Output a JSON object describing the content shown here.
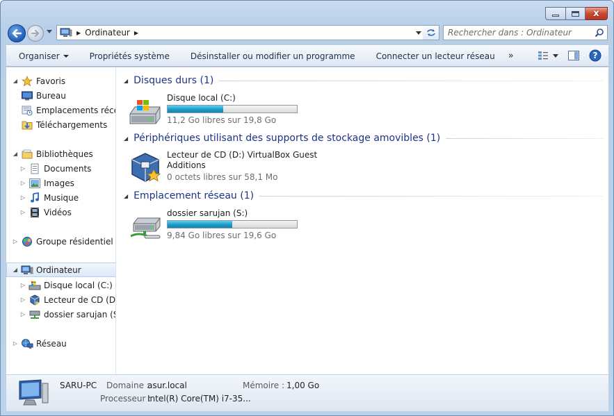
{
  "window": {
    "close_label": "x"
  },
  "address_bar": {
    "crumb": "Ordinateur"
  },
  "search": {
    "placeholder": "Rechercher dans : Ordinateur"
  },
  "command_bar": {
    "organize": "Organiser",
    "system_properties": "Propriétés système",
    "uninstall": "Désinstaller ou modifier un programme",
    "map_drive": "Connecter un lecteur réseau",
    "more": "»"
  },
  "nav_pane": {
    "favorites": "Favoris",
    "desktop": "Bureau",
    "recent_places": "Emplacements récents",
    "downloads": "Téléchargements",
    "libraries": "Bibliothèques",
    "documents": "Documents",
    "images": "Images",
    "music": "Musique",
    "videos": "Vidéos",
    "homegroup": "Groupe résidentiel",
    "computer": "Ordinateur",
    "local_disk": "Disque local (C:)",
    "cd_drive": "Lecteur de CD (D:) VirtualBox Guest Additions",
    "network_share": "dossier sarujan (S:)",
    "network": "Réseau"
  },
  "groups": {
    "hard_disks": "Disques durs (1)",
    "removable": "Périphériques utilisant des supports de stockage amovibles (1)",
    "network_locations": "Emplacement réseau (1)"
  },
  "drives": {
    "c": {
      "name": "Disque local (C:)",
      "free": "11,2 Go libres sur 19,8 Go",
      "used_fraction": 0.43
    },
    "d": {
      "name_line1": "Lecteur de CD (D:) VirtualBox Guest",
      "name_line2": "Additions",
      "free": "0 octets libres sur 58,1 Mo"
    },
    "s": {
      "name": "dossier sarujan (S:)",
      "free": "9,84 Go libres sur 19,6 Go",
      "used_fraction": 0.5
    }
  },
  "details": {
    "computer_name": "SARU-PC",
    "domain_label": "Domaine :",
    "domain_value": "asur.local",
    "memory_label": "Mémoire :",
    "memory_value": "1,00 Go",
    "processor_label": "Processeur :",
    "processor_value": "Intel(R) Core(TM) i7-35..."
  }
}
